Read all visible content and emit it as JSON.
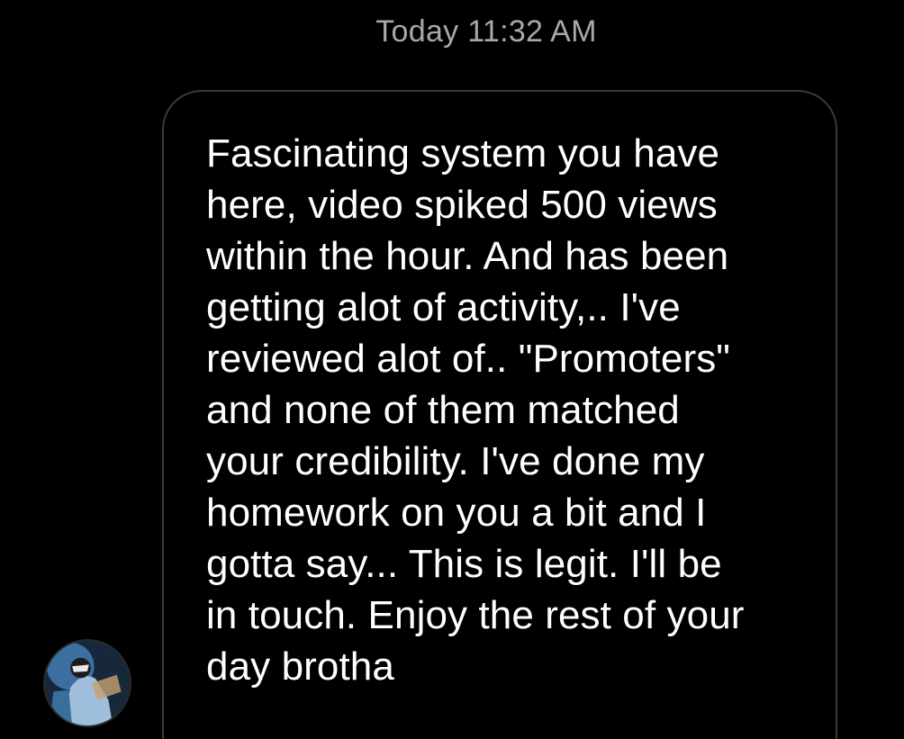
{
  "header": {
    "timestamp": "Today 11:32 AM"
  },
  "message": {
    "text": "Fascinating system you have\nhere, video spiked 500 views\nwithin the hour. And has been\ngetting alot of activity,.. I've\nreviewed alot of.. \"Promoters\"\nand none of them matched\nyour credibility. I've done my\nhomework on you a bit and I\ngotta say... This is legit.  I'll be\nin touch. Enjoy the rest of your\nday brotha",
    "sender_avatar_icon": "user-avatar"
  },
  "colors": {
    "background": "#000000",
    "bubble_border": "#3a3a3a",
    "text": "#ffffff",
    "timestamp": "#a8a8a8"
  }
}
